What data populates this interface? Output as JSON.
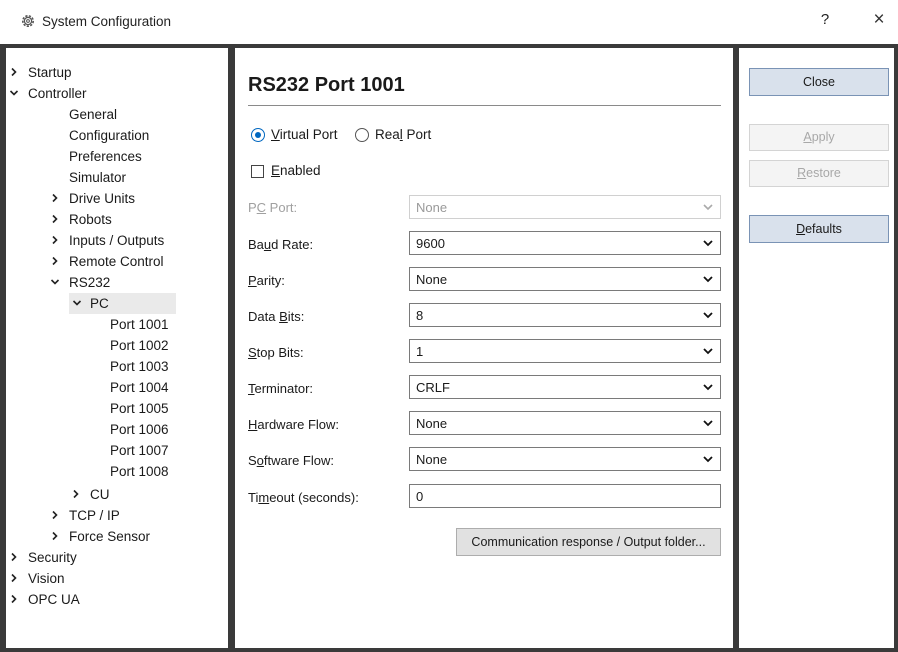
{
  "window": {
    "title": "System Configuration",
    "help_label": "?",
    "close_label": "×"
  },
  "tree": {
    "startup": "Startup",
    "controller": "Controller",
    "general": "General",
    "configuration": "Configuration",
    "preferences": "Preferences",
    "simulator": "Simulator",
    "drive_units": "Drive Units",
    "robots": "Robots",
    "inputs_outputs": "Inputs / Outputs",
    "remote_control": "Remote Control",
    "rs232": "RS232",
    "pc": "PC",
    "ports": [
      "Port 1001",
      "Port 1002",
      "Port 1003",
      "Port 1004",
      "Port 1005",
      "Port 1006",
      "Port 1007",
      "Port 1008"
    ],
    "cu": "CU",
    "tcp_ip": "TCP / IP",
    "force_sensor": "Force Sensor",
    "security": "Security",
    "vision": "Vision",
    "opc_ua": "OPC UA"
  },
  "main": {
    "heading": "RS232 Port 1001",
    "virtual_port": {
      "pre": "",
      "key": "V",
      "post": "irtual Port",
      "selected": true
    },
    "real_port": {
      "pre": "Rea",
      "key": "l",
      "post": " Port",
      "selected": false
    },
    "enabled": {
      "pre": "",
      "key": "E",
      "post": "nabled",
      "checked": false
    },
    "fields": {
      "pc_port": {
        "pre": "P",
        "key": "C",
        "post": " Port:",
        "value": "None",
        "disabled": true
      },
      "baud_rate": {
        "pre": "Ba",
        "key": "u",
        "post": "d Rate:",
        "value": "9600"
      },
      "parity": {
        "pre": "",
        "key": "P",
        "post": "arity:",
        "value": "None"
      },
      "data_bits": {
        "pre": "Data ",
        "key": "B",
        "post": "its:",
        "value": "8"
      },
      "stop_bits": {
        "pre": "",
        "key": "S",
        "post": "top Bits:",
        "value": "1"
      },
      "terminator": {
        "pre": "",
        "key": "T",
        "post": "erminator:",
        "value": "CRLF"
      },
      "hardware_flow": {
        "pre": "",
        "key": "H",
        "post": "ardware Flow:",
        "value": "None"
      },
      "software_flow": {
        "pre": "S",
        "key": "o",
        "post": "ftware Flow:",
        "value": "None"
      },
      "timeout": {
        "pre": "Ti",
        "key": "m",
        "post": "eout (seconds):",
        "value": "0"
      }
    },
    "comm_button": "Communication response / Output folder..."
  },
  "buttons": {
    "close": "Close",
    "apply": {
      "pre": "",
      "key": "A",
      "post": "pply"
    },
    "restore": {
      "pre": "",
      "key": "R",
      "post": "estore"
    },
    "defaults": {
      "pre": "",
      "key": "D",
      "post": "efaults"
    }
  },
  "colors": {
    "accent": "#0067c0",
    "frame": "#3a3a3a",
    "disabled_text": "#a0a0a0"
  }
}
